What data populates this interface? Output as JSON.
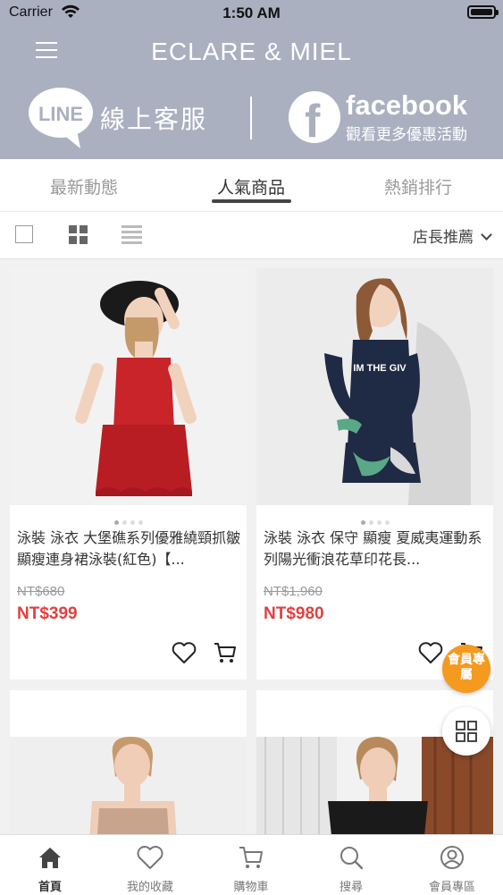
{
  "status_bar": {
    "carrier": "Carrier",
    "time": "1:50 AM"
  },
  "header": {
    "brand": "ECLARE & MIEL",
    "line": {
      "logo_text": "LINE",
      "label": "線上客服"
    },
    "facebook": {
      "title": "facebook",
      "subtitle": "觀看更多優惠活動"
    }
  },
  "tabs": [
    {
      "label": "最新動態",
      "active": false
    },
    {
      "label": "人氣商品",
      "active": true
    },
    {
      "label": "熱銷排行",
      "active": false
    }
  ],
  "toolbar": {
    "sort_label": "店長推薦"
  },
  "products": [
    {
      "title": "泳裝 泳衣 大堡礁系列優雅繞頸抓皺顯瘦連身裙泳裝(紅色)【...",
      "price_original": "NT$680",
      "price_sale": "NT$399"
    },
    {
      "title": "泳裝 泳衣 保守 顯瘦 夏威夷運動系列陽光衝浪花草印花長...",
      "price_original": "NT$1,960",
      "price_sale": "NT$980"
    }
  ],
  "fab": {
    "member_label": "會員專屬"
  },
  "bottom_nav": [
    {
      "label": "首頁",
      "icon": "home-icon",
      "active": true
    },
    {
      "label": "我的收藏",
      "icon": "heart-icon",
      "active": false
    },
    {
      "label": "購物車",
      "icon": "cart-icon",
      "active": false
    },
    {
      "label": "搜尋",
      "icon": "search-icon",
      "active": false
    },
    {
      "label": "會員專區",
      "icon": "user-icon",
      "active": false
    }
  ],
  "colors": {
    "header_bg": "#aab0c0",
    "sale_price": "#e04040",
    "fab_member": "#f39a1f"
  }
}
